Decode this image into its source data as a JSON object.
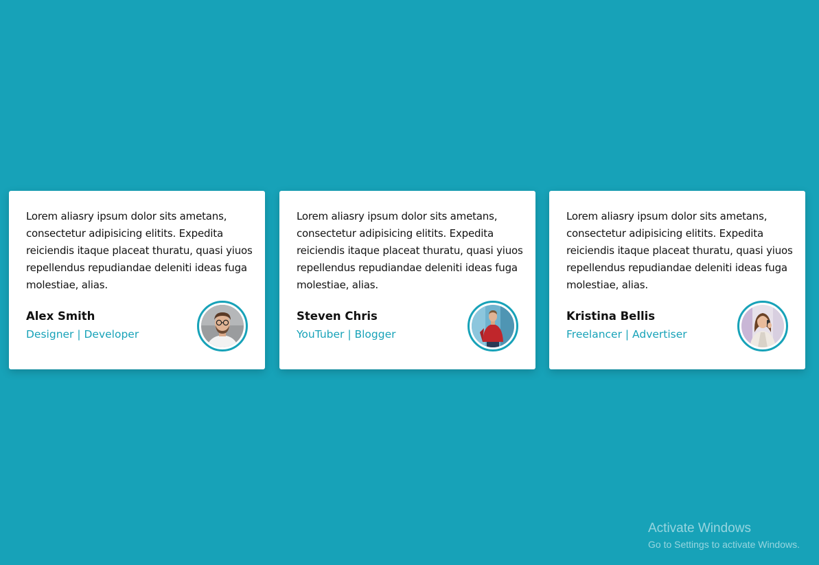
{
  "colors": {
    "background": "#17a2b8",
    "accent": "#17a2b8",
    "card": "#ffffff",
    "text": "#111111"
  },
  "cards": [
    {
      "quote": "Lorem aliasry ipsum dolor sits ametans, consectetur adipisicing elitits. Expedita reiciendis itaque placeat thuratu, quasi yiuos repellendus repudiandae deleniti ideas fuga molestiae, alias.",
      "name": "Alex Smith",
      "role": "Designer | Developer",
      "avatar_icon": "man-glasses-avatar"
    },
    {
      "quote": "Lorem aliasry ipsum dolor sits ametans, consectetur adipisicing elitits. Expedita reiciendis itaque placeat thuratu, quasi yiuos repellendus repudiandae deleniti ideas fuga molestiae, alias.",
      "name": "Steven Chris",
      "role": "YouTuber | Blogger",
      "avatar_icon": "man-red-shirt-avatar"
    },
    {
      "quote": "Lorem aliasry ipsum dolor sits ametans, consectetur adipisicing elitits. Expedita reiciendis itaque placeat thuratu, quasi yiuos repellendus repudiandae deleniti ideas fuga molestiae, alias.",
      "name": "Kristina Bellis",
      "role": "Freelancer | Advertiser",
      "avatar_icon": "woman-phone-avatar"
    }
  ],
  "watermark": {
    "title": "Activate Windows",
    "subtitle": "Go to Settings to activate Windows."
  }
}
